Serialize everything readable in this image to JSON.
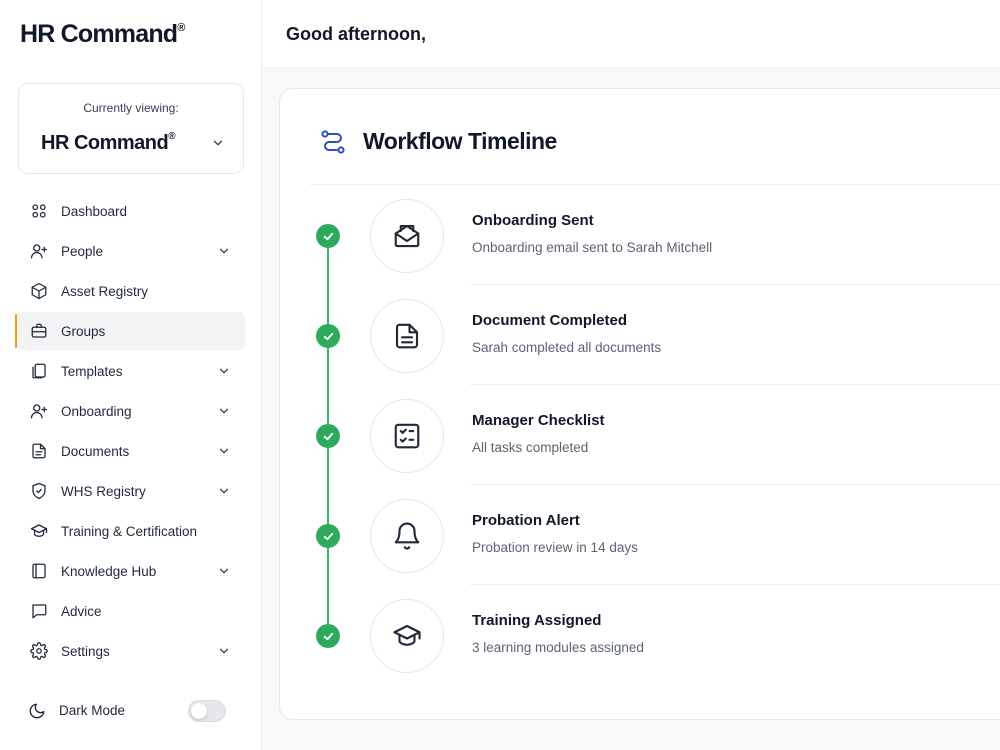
{
  "brand": {
    "name": "HR Command",
    "mark": "®"
  },
  "org_switcher": {
    "caption": "Currently viewing:",
    "name": "HR Command",
    "mark": "®"
  },
  "nav": {
    "items": [
      {
        "label": "Dashboard",
        "icon": "grid-icon",
        "has_chevron": false,
        "active": false
      },
      {
        "label": "People",
        "icon": "user-plus-icon",
        "has_chevron": true,
        "active": false
      },
      {
        "label": "Asset Registry",
        "icon": "box-icon",
        "has_chevron": false,
        "active": false
      },
      {
        "label": "Groups",
        "icon": "briefcase-icon",
        "has_chevron": false,
        "active": true
      },
      {
        "label": "Templates",
        "icon": "copy-icon",
        "has_chevron": true,
        "active": false
      },
      {
        "label": "Onboarding",
        "icon": "user-plus-icon",
        "has_chevron": true,
        "active": false
      },
      {
        "label": "Documents",
        "icon": "file-icon",
        "has_chevron": true,
        "active": false
      },
      {
        "label": "WHS Registry",
        "icon": "shield-check-icon",
        "has_chevron": true,
        "active": false
      },
      {
        "label": "Training & Certification",
        "icon": "graduation-cap-icon",
        "has_chevron": false,
        "active": false
      },
      {
        "label": "Knowledge Hub",
        "icon": "book-icon",
        "has_chevron": true,
        "active": false
      },
      {
        "label": "Advice",
        "icon": "chat-bubble-icon",
        "has_chevron": false,
        "active": false
      },
      {
        "label": "Settings",
        "icon": "gear-icon",
        "has_chevron": true,
        "active": false
      }
    ],
    "active_accent": "#f59e0b"
  },
  "dark_mode": {
    "label": "Dark Mode",
    "enabled": false
  },
  "header": {
    "greeting": "Good afternoon,"
  },
  "workflow": {
    "title": "Workflow Timeline",
    "accent": "#2eaa5c",
    "events": [
      {
        "title": "Onboarding Sent",
        "description": "Onboarding email sent to Sarah Mitchell",
        "icon": "envelope-open-icon",
        "completed": true
      },
      {
        "title": "Document Completed",
        "description": "Sarah completed all documents",
        "icon": "document-icon",
        "completed": true
      },
      {
        "title": "Manager Checklist",
        "description": "All tasks completed",
        "icon": "checklist-icon",
        "completed": true
      },
      {
        "title": "Probation Alert",
        "description": "Probation review in 14 days",
        "icon": "bell-icon",
        "completed": true
      },
      {
        "title": "Training Assigned",
        "description": "3 learning modules assigned",
        "icon": "graduation-cap-icon",
        "completed": true
      }
    ]
  }
}
